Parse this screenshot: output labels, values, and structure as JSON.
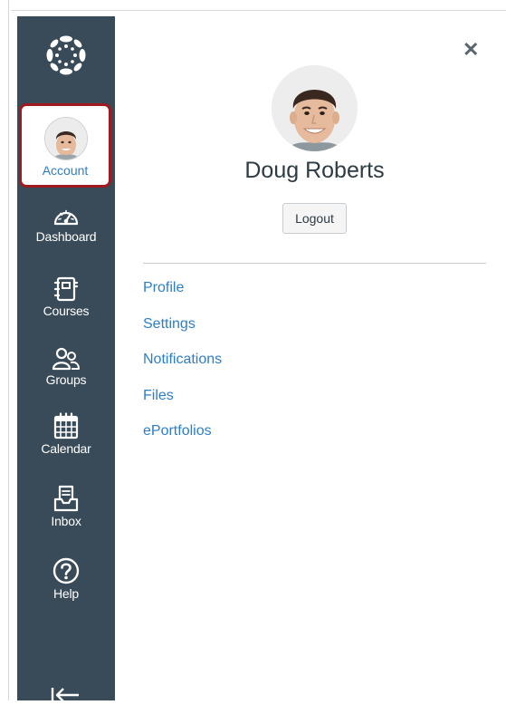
{
  "nav": {
    "account_label": "Account",
    "items": [
      {
        "label": "Dashboard",
        "icon": "dashboard-icon"
      },
      {
        "label": "Courses",
        "icon": "courses-icon"
      },
      {
        "label": "Groups",
        "icon": "groups-icon"
      },
      {
        "label": "Calendar",
        "icon": "calendar-icon"
      },
      {
        "label": "Inbox",
        "icon": "inbox-icon"
      },
      {
        "label": "Help",
        "icon": "help-icon"
      }
    ],
    "collapse_icon": "collapse-nav-icon"
  },
  "tray": {
    "user_name": "Doug Roberts",
    "logout_label": "Logout",
    "links": [
      "Profile",
      "Settings",
      "Notifications",
      "Files",
      "ePortfolios"
    ]
  },
  "colors": {
    "sidebar": "#394b58",
    "link": "#2d7ec7",
    "highlight_border": "#9e1a1f",
    "text": "#2d3b45"
  }
}
